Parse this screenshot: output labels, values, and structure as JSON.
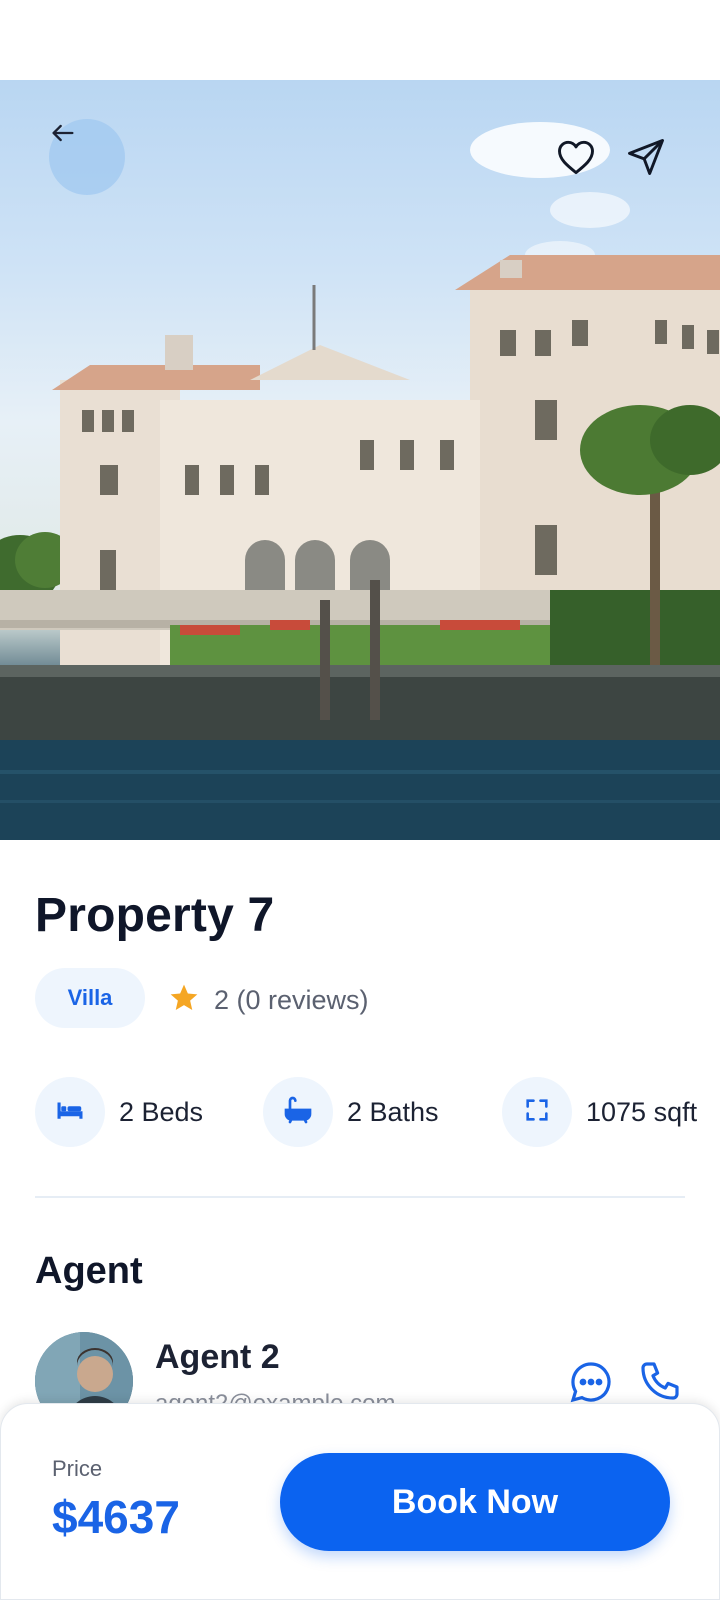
{
  "property": {
    "title": "Property 7",
    "type": "Villa",
    "rating": "2 (0 reviews)",
    "features": [
      {
        "label": "2 Beds",
        "icon": "bed-icon"
      },
      {
        "label": "2 Baths",
        "icon": "bath-icon"
      },
      {
        "label": "1075 sqft",
        "icon": "area-expand-icon"
      }
    ]
  },
  "agent_section": {
    "title": "Agent",
    "name": "Agent 2",
    "email": "agent2@example.com"
  },
  "booking": {
    "price_label": "Price",
    "price_value": "$4637",
    "button_label": "Book Now"
  },
  "colors": {
    "accent": "#0b63f0",
    "chip_bg": "#eef5fd",
    "star": "#f5a623"
  },
  "hero_icons": [
    "arrow-left-icon",
    "heart-icon",
    "send-icon"
  ]
}
